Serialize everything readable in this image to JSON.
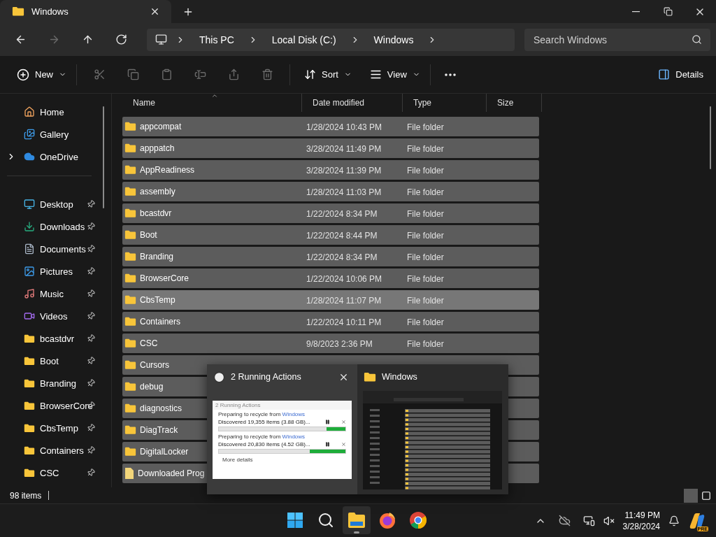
{
  "window": {
    "title": "Windows"
  },
  "nav": [
    {
      "kind": "back",
      "disabled": false
    },
    {
      "kind": "forward",
      "disabled": true
    },
    {
      "kind": "up",
      "disabled": false
    },
    {
      "kind": "refresh",
      "disabled": false
    }
  ],
  "address": {
    "crumbs": [
      "This PC",
      "Local Disk (C:)",
      "Windows"
    ]
  },
  "search": {
    "placeholder": "Search Windows"
  },
  "toolbar": {
    "new": "New",
    "actions": [
      {
        "kind": "cut",
        "disabled": true
      },
      {
        "kind": "copy",
        "disabled": true
      },
      {
        "kind": "paste",
        "disabled": true
      },
      {
        "kind": "rename",
        "disabled": true
      },
      {
        "kind": "share",
        "disabled": true
      },
      {
        "kind": "delete",
        "disabled": true
      }
    ],
    "sort": "Sort",
    "view": "View",
    "details": "Details"
  },
  "sidebar": {
    "top": [
      {
        "kind": "home",
        "label": "Home"
      },
      {
        "kind": "gallery",
        "label": "Gallery"
      },
      {
        "kind": "onedrive",
        "label": "OneDrive",
        "expanded": false
      }
    ],
    "quick": [
      {
        "kind": "desktop",
        "label": "Desktop",
        "pinned": true
      },
      {
        "kind": "downloads",
        "label": "Downloads",
        "pinned": true
      },
      {
        "kind": "documents",
        "label": "Documents",
        "pinned": true
      },
      {
        "kind": "pictures",
        "label": "Pictures",
        "pinned": true
      },
      {
        "kind": "music",
        "label": "Music",
        "pinned": true
      },
      {
        "kind": "videos",
        "label": "Videos",
        "pinned": true
      },
      {
        "kind": "folder",
        "label": "bcastdvr",
        "pinned": true
      },
      {
        "kind": "folder",
        "label": "Boot",
        "pinned": true
      },
      {
        "kind": "folder",
        "label": "Branding",
        "pinned": true
      },
      {
        "kind": "folder",
        "label": "BrowserCore",
        "pinned": true
      },
      {
        "kind": "folder",
        "label": "CbsTemp",
        "pinned": true
      },
      {
        "kind": "folder",
        "label": "Containers",
        "pinned": true
      },
      {
        "kind": "folder",
        "label": "CSC",
        "pinned": true
      }
    ]
  },
  "columns": [
    "Name",
    "Date modified",
    "Type",
    "Size"
  ],
  "rows": [
    {
      "name": "appcompat",
      "date": "1/28/2024 10:43 PM",
      "type": "File folder",
      "selected": true,
      "hovered": false
    },
    {
      "name": "apppatch",
      "date": "3/28/2024 11:49 PM",
      "type": "File folder",
      "selected": true,
      "hovered": false
    },
    {
      "name": "AppReadiness",
      "date": "3/28/2024 11:39 PM",
      "type": "File folder",
      "selected": true,
      "hovered": false
    },
    {
      "name": "assembly",
      "date": "1/28/2024 11:03 PM",
      "type": "File folder",
      "selected": true,
      "hovered": false
    },
    {
      "name": "bcastdvr",
      "date": "1/22/2024 8:34 PM",
      "type": "File folder",
      "selected": true,
      "hovered": false
    },
    {
      "name": "Boot",
      "date": "1/22/2024 8:44 PM",
      "type": "File folder",
      "selected": true,
      "hovered": false
    },
    {
      "name": "Branding",
      "date": "1/22/2024 8:34 PM",
      "type": "File folder",
      "selected": true,
      "hovered": false
    },
    {
      "name": "BrowserCore",
      "date": "1/22/2024 10:06 PM",
      "type": "File folder",
      "selected": true,
      "hovered": false
    },
    {
      "name": "CbsTemp",
      "date": "1/28/2024 11:07 PM",
      "type": "File folder",
      "selected": true,
      "hovered": true
    },
    {
      "name": "Containers",
      "date": "1/22/2024 10:11 PM",
      "type": "File folder",
      "selected": true,
      "hovered": false
    },
    {
      "name": "CSC",
      "date": "9/8/2023 2:36 PM",
      "type": "File folder",
      "selected": true,
      "hovered": false
    },
    {
      "name": "Cursors",
      "selected": true,
      "hovered": false
    },
    {
      "name": "debug",
      "selected": true,
      "hovered": false
    },
    {
      "name": "diagnostics",
      "selected": true,
      "hovered": false
    },
    {
      "name": "DiagTrack",
      "selected": true,
      "hovered": false
    },
    {
      "name": "DigitalLocker",
      "selected": true,
      "hovered": false
    },
    {
      "name": "Downloaded Prog",
      "kind": "file",
      "selected": true,
      "hovered": false
    }
  ],
  "status": {
    "count": "98 items",
    "views": [
      {
        "kind": "details",
        "selected": true
      },
      {
        "kind": "tiles",
        "selected": false
      }
    ]
  },
  "preview": {
    "cards": [
      {
        "kind": "dialog",
        "title": "2 Running Actions",
        "hovered": true,
        "dialog": {
          "title": "2 Running Actions",
          "tasks": [
            {
              "label": "Preparing to recycle from",
              "link": "Windows",
              "status": "Discovered 19,355 items (3.88 GB)...",
              "level": 0.15
            },
            {
              "label": "Preparing to recycle from",
              "link": "Windows",
              "status": "Discovered 20,830 items (4.52 GB)...",
              "level": 0.28
            }
          ],
          "more": "More details"
        }
      },
      {
        "kind": "explorer",
        "title": "Windows",
        "hovered": false
      }
    ]
  },
  "taskbar": {
    "apps": [
      {
        "kind": "start",
        "active": false
      },
      {
        "kind": "search",
        "active": false
      },
      {
        "kind": "explorer",
        "active": true
      },
      {
        "kind": "firefox",
        "active": false
      },
      {
        "kind": "chrome",
        "active": false
      }
    ],
    "time": "11:49 PM",
    "date": "3/28/2024",
    "badge": "PRE"
  }
}
